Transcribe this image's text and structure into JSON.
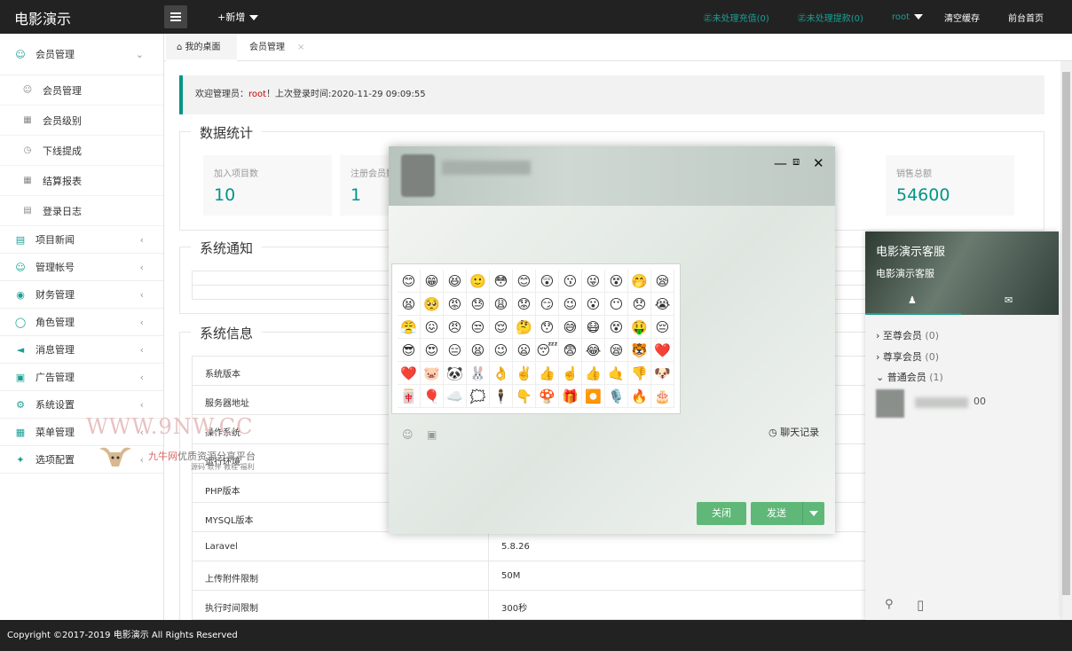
{
  "app": {
    "title": "电影演示",
    "new_label": "+新增"
  },
  "header": {
    "pending_recharge": "㊣未处理充值(0)",
    "pending_withdraw": "㊣未处理提款(0)",
    "user": "root",
    "clear_cache": "清空缓存",
    "front_page": "前台首页"
  },
  "sidebar": {
    "member_group": "会员管理",
    "member_items": [
      "会员管理",
      "会员级别",
      "下线提成",
      "结算报表",
      "登录日志"
    ],
    "items": [
      "项目新闻",
      "管理帐号",
      "财务管理",
      "角色管理",
      "消息管理",
      "广告管理",
      "系统设置",
      "菜单管理",
      "选项配置"
    ]
  },
  "tabs": {
    "home": "我的桌面",
    "member": "会员管理"
  },
  "welcome": {
    "prefix": "欢迎管理员：",
    "user": "root",
    "suffix": "！上次登录时间:2020-11-29 09:09:55"
  },
  "stats": {
    "legend": "数据统计",
    "items": [
      {
        "label": "加入项目数",
        "value": "10"
      },
      {
        "label": "注册会员数",
        "value": "1"
      },
      {
        "label": "销售总额",
        "value": "54600"
      }
    ]
  },
  "notice": {
    "legend": "系统通知"
  },
  "sysinfo": {
    "legend": "系统信息",
    "rows": [
      {
        "k": "系统版本",
        "v": ""
      },
      {
        "k": "服务器地址",
        "v": ""
      },
      {
        "k": "操作系统",
        "v": ""
      },
      {
        "k": "运行环境",
        "v": ""
      },
      {
        "k": "PHP版本",
        "v": ""
      },
      {
        "k": "MYSQL版本",
        "v": ""
      },
      {
        "k": "Laravel",
        "v": "5.8.26"
      },
      {
        "k": "上传附件限制",
        "v": "50M"
      },
      {
        "k": "执行时间限制",
        "v": "300秒"
      }
    ]
  },
  "chat": {
    "history": "聊天记录",
    "close": "关闭",
    "send": "发送",
    "emojis": [
      "😊",
      "😁",
      "😆",
      "🙂",
      "😳",
      "😊",
      "😲",
      "😗",
      "😜",
      "😵",
      "🤭",
      "😪",
      "😫",
      "🥺",
      "😡",
      "😓",
      "😩",
      "😟",
      "😏",
      "😉",
      "😮",
      "😶",
      "😞",
      "😭",
      "😤",
      "😖",
      "😠",
      "😒",
      "😌",
      "🤔",
      "😯",
      "😅",
      "😷",
      "😵",
      "🤑",
      "😔",
      "😎",
      "😍",
      "😑",
      "😫",
      "😉",
      "😦",
      "😴",
      "😨",
      "😂",
      "😪",
      "🐯",
      "❤️",
      "❤️",
      "🐷",
      "🐼",
      "🐰",
      "👌",
      "✌️",
      "👍",
      "☝️",
      "👍",
      "🤙",
      "👎",
      "🐶",
      "🀄",
      "🎈",
      "☁️",
      "🗯️",
      "🕴️",
      "👇",
      "🍄",
      "🎁",
      "⏺️",
      "🎙️",
      "🔥",
      "🎂"
    ]
  },
  "service": {
    "title": "电影演示客服",
    "subtitle": "电影演示客服",
    "groups": [
      {
        "name": "至尊会员",
        "count": "(0)"
      },
      {
        "name": "尊享会员",
        "count": "(0)"
      },
      {
        "name": "普通会员",
        "count": "(1)"
      }
    ],
    "member_suffix": "00"
  },
  "watermark": {
    "site": "WWW.9NW.CC",
    "brand": "九牛网",
    "slogan": "优质资源分享平台",
    "sub": "源码 软件 教程 福利"
  },
  "footer": {
    "copyright": "Copyright ©2017-2019 电影演示 All Rights Reserved"
  },
  "colors": {
    "accent": "#009688",
    "green_btn": "#5fb878",
    "topbar": "#222222"
  }
}
